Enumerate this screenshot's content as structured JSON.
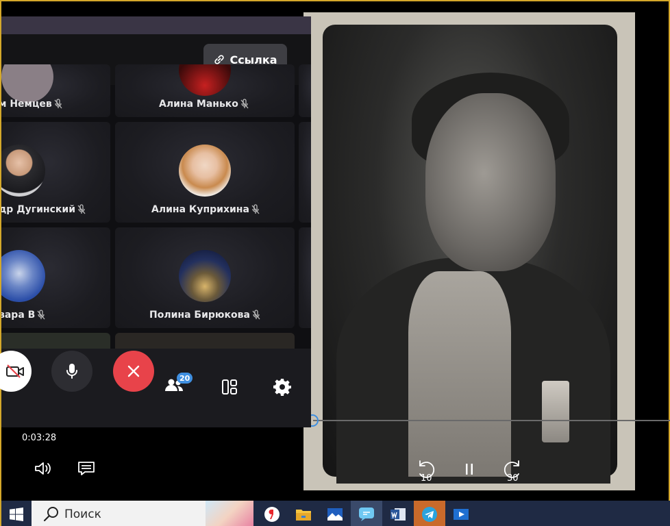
{
  "call": {
    "link_button_label": "Ссылка",
    "participants": [
      {
        "name": "м Немцев"
      },
      {
        "name": "Алина Манько"
      },
      {
        "name": "др Дугинский"
      },
      {
        "name": "Алина Куприхина"
      },
      {
        "name": "вара В"
      },
      {
        "name": "Полина Бирюкова"
      }
    ],
    "participant_count": "20",
    "colors": {
      "end_call": "#e8434a",
      "badge": "#3f8fe0"
    }
  },
  "player": {
    "elapsed": "0:03:28",
    "rewind_seconds": "10",
    "forward_seconds": "30",
    "progress_fraction": 0.02
  },
  "taskbar": {
    "search_placeholder": "Поиск",
    "apps": [
      "yandex-browser-icon",
      "file-explorer-icon",
      "photos-icon",
      "chat-app-icon",
      "word-icon",
      "telegram-icon",
      "media-player-icon"
    ]
  }
}
